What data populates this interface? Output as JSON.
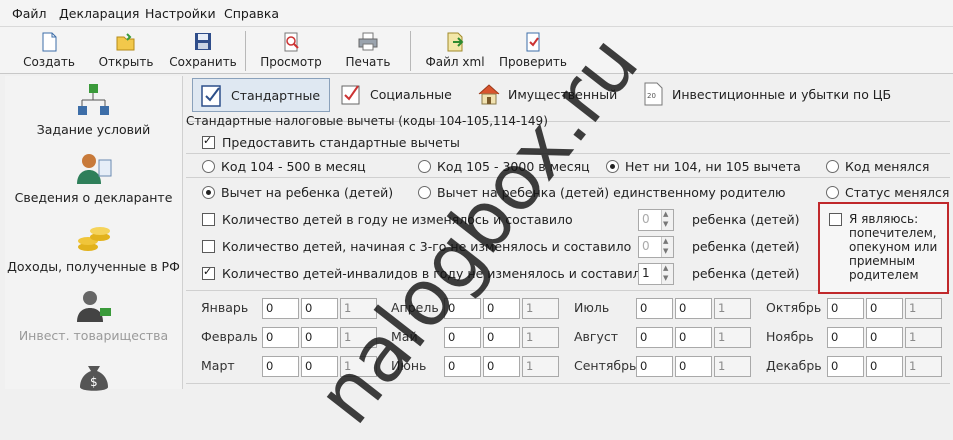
{
  "menu": {
    "items": [
      "Файл",
      "Декларация",
      "Настройки",
      "Справка"
    ]
  },
  "toolbar": {
    "buttons": [
      {
        "label": "Создать",
        "icon": "new-document-icon"
      },
      {
        "label": "Открыть",
        "icon": "open-folder-icon"
      },
      {
        "label": "Сохранить",
        "icon": "save-disk-icon"
      },
      {
        "label": "Просмотр",
        "icon": "preview-icon"
      },
      {
        "label": "Печать",
        "icon": "printer-icon"
      },
      {
        "label": "Файл xml",
        "icon": "xml-export-icon"
      },
      {
        "label": "Проверить",
        "icon": "check-document-icon"
      }
    ]
  },
  "sidebar": {
    "items": [
      {
        "label": "Задание условий",
        "icon": "conditions-tree-icon",
        "disabled": false
      },
      {
        "label": "Сведения о декларанте",
        "icon": "declarant-person-icon",
        "disabled": false
      },
      {
        "label": "Доходы, полученные в РФ",
        "icon": "coins-icon",
        "disabled": false
      },
      {
        "label": "Инвест. товарищества",
        "icon": "investor-icon",
        "disabled": true
      }
    ]
  },
  "tabs": [
    {
      "label": "Стандартные",
      "icon": "standard-checklist-icon",
      "active": true
    },
    {
      "label": "Социальные",
      "icon": "social-check-icon",
      "active": false
    },
    {
      "label": "Имущественный",
      "icon": "house-icon",
      "active": false
    },
    {
      "label": "Инвестиционные и убытки по ЦБ",
      "icon": "investment-doc-icon",
      "active": false
    }
  ],
  "group": {
    "title": "Стандартные налоговые вычеты (коды 104-105,114-149)",
    "provide_checkbox": {
      "label": "Предоставить стандартные вычеты",
      "checked": true
    },
    "code_radios": [
      {
        "label": "Код 104 - 500 в месяц",
        "checked": false
      },
      {
        "label": "Код 105 - 3000 в месяц",
        "checked": false
      },
      {
        "label": "Нет ни 104, ни 105 вычета",
        "checked": true
      },
      {
        "label": "Код менялся",
        "checked": false
      }
    ],
    "child_radios": [
      {
        "label": "Вычет на ребенка (детей)",
        "checked": true
      },
      {
        "label": "Вычет на ребенка (детей) единственному родителю",
        "checked": false
      },
      {
        "label": "Статус менялся",
        "checked": false
      }
    ],
    "child_rows": [
      {
        "label": "Количество детей в году не изменялось и составило",
        "checked": false,
        "value": "0",
        "unit": "ребенка (детей)",
        "enabled": false
      },
      {
        "label": "Количество детей, начиная с 3-го не изменялось и составило",
        "checked": false,
        "value": "0",
        "unit": "ребенка (детей)",
        "enabled": false
      },
      {
        "label": "Количество детей-инвалидов в году не изменялось и составило",
        "checked": true,
        "value": "1",
        "unit": "ребенка (детей)",
        "enabled": true
      }
    ],
    "guardian_checkbox": {
      "label": "Я являюсь: попечителем, опекуном или приемным родителем",
      "checked": false
    }
  },
  "months": [
    {
      "name": "Январь",
      "v1": "0",
      "v2": "0",
      "v3": "1"
    },
    {
      "name": "Февраль",
      "v1": "0",
      "v2": "0",
      "v3": "1"
    },
    {
      "name": "Март",
      "v1": "0",
      "v2": "0",
      "v3": "1"
    },
    {
      "name": "Апрель",
      "v1": "0",
      "v2": "0",
      "v3": "1"
    },
    {
      "name": "Май",
      "v1": "0",
      "v2": "0",
      "v3": "1"
    },
    {
      "name": "Июнь",
      "v1": "0",
      "v2": "0",
      "v3": "1"
    },
    {
      "name": "Июль",
      "v1": "0",
      "v2": "0",
      "v3": "1"
    },
    {
      "name": "Август",
      "v1": "0",
      "v2": "0",
      "v3": "1"
    },
    {
      "name": "Сентябрь",
      "v1": "0",
      "v2": "0",
      "v3": "1"
    },
    {
      "name": "Октябрь",
      "v1": "0",
      "v2": "0",
      "v3": "1"
    },
    {
      "name": "Ноябрь",
      "v1": "0",
      "v2": "0",
      "v3": "1"
    },
    {
      "name": "Декабрь",
      "v1": "0",
      "v2": "0",
      "v3": "1"
    }
  ],
  "watermark": "nalogbox.ru",
  "colors": {
    "highlight_border": "#c0282b",
    "active_tab_bg": "#dfe8f2"
  }
}
